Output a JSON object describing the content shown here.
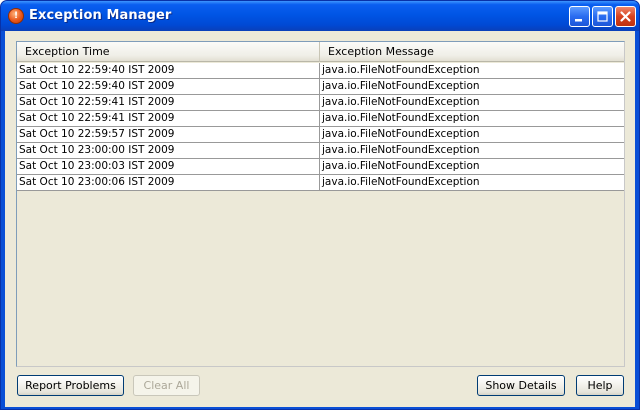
{
  "window": {
    "title": "Exception Manager",
    "app_icon_glyph": "!",
    "controls": [
      "minimize-icon",
      "maximize-icon",
      "close-icon"
    ]
  },
  "table": {
    "columns": [
      "Exception Time",
      "Exception Message"
    ],
    "rows": [
      {
        "time": "Sat Oct 10 22:59:40 IST 2009",
        "message": "java.io.FileNotFoundException"
      },
      {
        "time": "Sat Oct 10 22:59:40 IST 2009",
        "message": "java.io.FileNotFoundException"
      },
      {
        "time": "Sat Oct 10 22:59:41 IST 2009",
        "message": "java.io.FileNotFoundException"
      },
      {
        "time": "Sat Oct 10 22:59:41 IST 2009",
        "message": "java.io.FileNotFoundException"
      },
      {
        "time": "Sat Oct 10 22:59:57 IST 2009",
        "message": "java.io.FileNotFoundException"
      },
      {
        "time": "Sat Oct 10 23:00:00 IST 2009",
        "message": "java.io.FileNotFoundException"
      },
      {
        "time": "Sat Oct 10 23:00:03 IST 2009",
        "message": "java.io.FileNotFoundException"
      },
      {
        "time": "Sat Oct 10 23:00:06 IST 2009",
        "message": "java.io.FileNotFoundException"
      }
    ]
  },
  "buttons": {
    "report_problems": "Report Problems",
    "clear_all": "Clear All",
    "show_details": "Show Details",
    "help": "Help"
  },
  "colors": {
    "titlebar": "#0055e5",
    "client_bg": "#ece9d8",
    "close_button": "#d6421f"
  }
}
